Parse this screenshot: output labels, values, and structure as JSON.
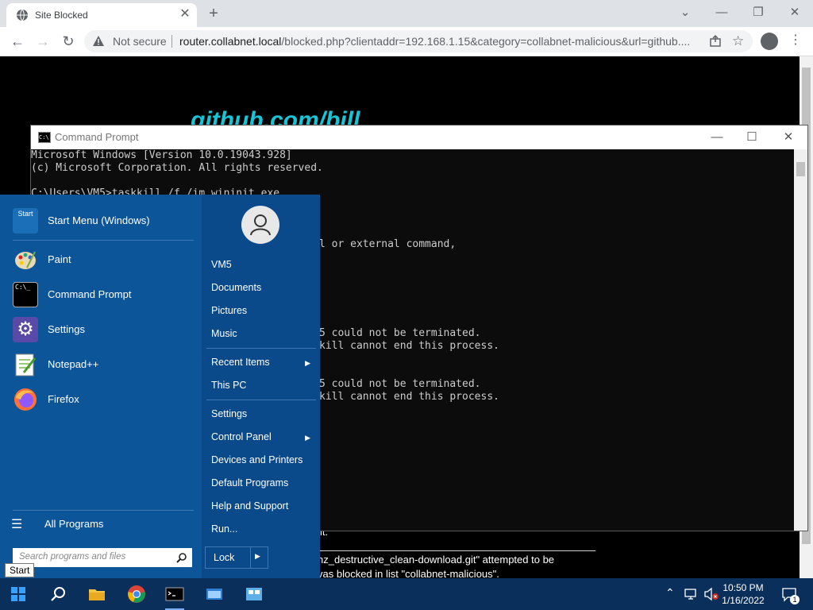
{
  "browser": {
    "tab_title": "Site Blocked",
    "url_security_label": "Not secure",
    "url_host": "router.collabnet.local",
    "url_rest": "/blocked.php?clientaddr=192.168.1.15&category=collabnet-malicious&url=github....",
    "close_glyph": "✕",
    "new_tab_glyph": "+",
    "back_glyph": "←",
    "forward_glyph": "→",
    "reload_glyph": "↻",
    "minimize_glyph": "—",
    "restore_glyph": "❐",
    "window_close_glyph": "✕",
    "collapse_glyph": "⌄",
    "star_glyph": "☆",
    "menu_glyph": "⋮"
  },
  "page": {
    "heading": "github.com/bill",
    "fragment": "it.",
    "line1": "nz_destructive_clean-download.git\" attempted to be",
    "line2": "vas blocked in list \"collabnet-malicious\"."
  },
  "cmd": {
    "title": "Command Prompt",
    "icon_text": "C:\\",
    "lines": [
      "Microsoft Windows [Version 10.0.19043.928]",
      "(c) Microsoft Corporation. All rights reserved.",
      "",
      "C:\\Users\\VM5>taskkill /f /im wininit.exe"
    ],
    "frag1": "l or external command,",
    "frag2": "5 could not be terminated.",
    "frag3": "kill cannot end this process.",
    "frag4": "5 could not be terminated.",
    "frag5": "kill cannot end this process."
  },
  "start_menu": {
    "header": "Start Menu (Windows)",
    "header_icon_text": "Start",
    "pinned": [
      "Paint",
      "Command Prompt",
      "Settings",
      "Notepad++",
      "Firefox"
    ],
    "all_programs": "All Programs",
    "search_placeholder": "Search programs and files",
    "right": {
      "user": "VM5",
      "documents": "Documents",
      "pictures": "Pictures",
      "music": "Music",
      "recent_items": "Recent Items",
      "this_pc": "This PC",
      "settings": "Settings",
      "control_panel": "Control Panel",
      "devices_printers": "Devices and Printers",
      "default_programs": "Default Programs",
      "help_support": "Help and Support",
      "run": "Run..."
    },
    "lock": "Lock",
    "tooltip": "Start"
  },
  "taskbar": {
    "time": "10:50 PM",
    "date": "1/16/2022",
    "notification_count": "1"
  }
}
